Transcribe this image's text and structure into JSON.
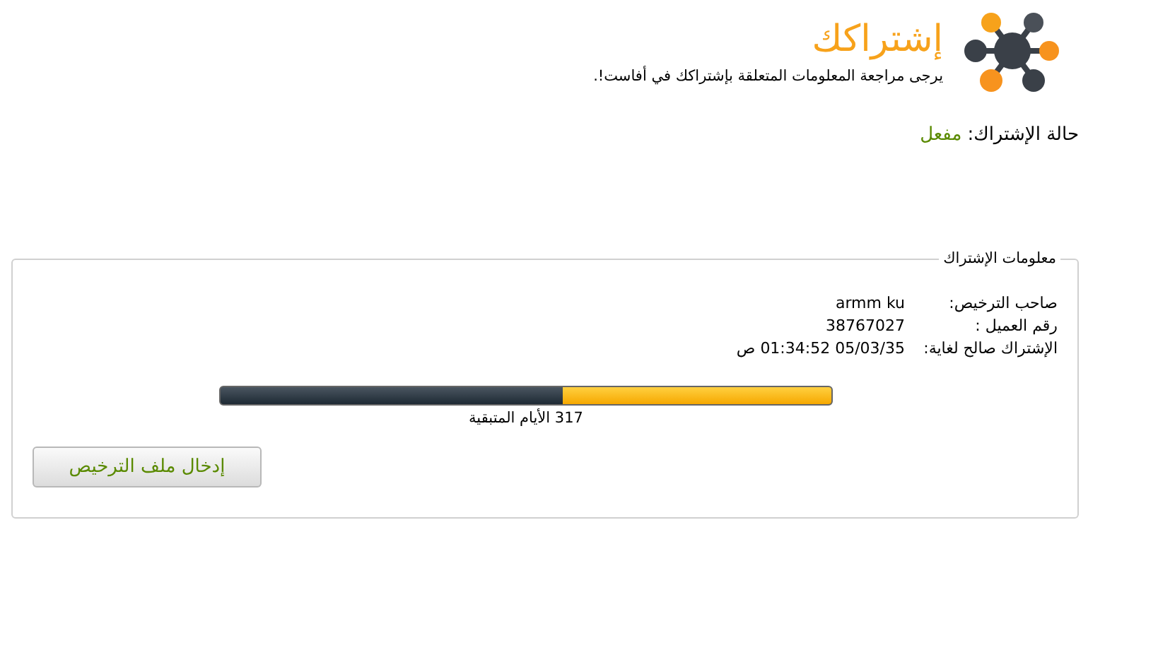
{
  "header": {
    "title": "إشتراكك",
    "subtitle": "يرجى مراجعة المعلومات المتعلقة بإشتراكك في أفاست!."
  },
  "status": {
    "label": "حالة الإشتراك:",
    "value": "مفعل"
  },
  "info": {
    "legend": "معلومات الإشتراك",
    "rows": [
      {
        "label": "صاحب الترخيص:",
        "value": "armm ku"
      },
      {
        "label": "رقم العميل :",
        "value": "38767027"
      },
      {
        "label": "الإشتراك صالح لغاية:",
        "value": "05/03/35 01:34:52 ص"
      }
    ],
    "progress": {
      "level": 0.44,
      "caption": "317 الأيام المتبقية"
    },
    "button": "إدخال ملف الترخيص"
  }
}
